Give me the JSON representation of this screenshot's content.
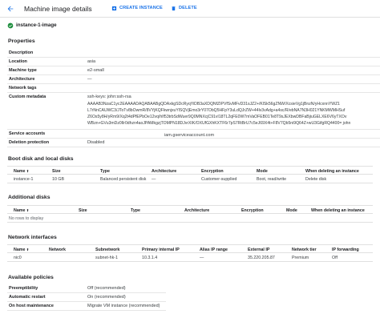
{
  "header": {
    "title": "Machine image details",
    "create_label": "CREATE INSTANCE",
    "delete_label": "DELETE"
  },
  "status": {
    "name": "instance-1-image"
  },
  "properties": {
    "title": "Properties",
    "rows": [
      {
        "key": "Description",
        "value": ""
      },
      {
        "key": "Location",
        "value": "asia"
      },
      {
        "key": "Machine type",
        "value": "e2-small"
      },
      {
        "key": "Architecture",
        "value": "—"
      },
      {
        "key": "Network tags",
        "value": ""
      },
      {
        "key": "Custom metadata",
        "value": "ssh-keys: john:ssh-rsa"
      }
    ],
    "metadata_lines": [
      "AAAAB3NzaC1yc2EAAAADAQABAABgQDAxkgSDcRyqYiDB3aXDQNfZIPVfSvMFvD31sJZ2+/KlSk56gZNW/XcsieVg1jBnzN/yHcxnnYWZ1",
      "L7rNnCAUWC3/JToTv8bOwmR/8VYjKQFkwnjxuYlSQVjEmo3rY07ObQ5HFpY3uLdQJrZW+44lv3vAdg+a4sc/R/ebNA7N3H021YNKMWMHSuf",
      "Z6Os5y8H/yRm9/Xq2t4dPfEPbOe12vq/hIf53trbSdWuer9Q0MNXcjC91vI18TL2qFE0W7mVaOFEB01Te8T9sJEXbwDBFaBjiuGELXE6V6yTXOv",
      "WBzn+GVu3mDz0Ilr0dhzn4aoJPAMkgzjTOMPN18DJvrXIK/OXUfGXhKXTF6r7pS7RtBrU7c5eJ69X4t+F8V7Qb5ni9Q64Z+wU3GifgRQ4400= john"
    ],
    "rows_after": [
      {
        "key": "Service accounts",
        "value": "iam.gserviceaccount.com"
      },
      {
        "key": "Deletion protection",
        "value": "Disabled"
      }
    ]
  },
  "boot_disks": {
    "title": "Boot disk and local disks",
    "headers": [
      "Name",
      "Size",
      "Type",
      "Architecture",
      "Encryption",
      "Mode",
      "When deleting an instance"
    ],
    "rows": [
      [
        "instance-1",
        "10 GB",
        "Balanced persistent disk",
        "—",
        "Customer-supplied",
        "Boot, read/write",
        "Delete disk"
      ]
    ]
  },
  "additional_disks": {
    "title": "Additional disks",
    "headers": [
      "Name",
      "Size",
      "Type",
      "Architecture",
      "Encryption",
      "Mode",
      "When deleting an instance"
    ],
    "empty_text": "No rows to display"
  },
  "network": {
    "title": "Network interfaces",
    "headers": [
      "Name",
      "Network",
      "Subnetwork",
      "Primary internal IP",
      "Alias IP range",
      "External IP",
      "Network tier",
      "IP forwarding"
    ],
    "rows": [
      [
        "nic0",
        "",
        "subnet-hk-1",
        "10.3.1.4",
        "—",
        "35.220.205.87",
        "Premium",
        "Off"
      ]
    ]
  },
  "policies": {
    "title": "Available policies",
    "rows": [
      {
        "key": "Preemptibility",
        "value": "Off (recommended)"
      },
      {
        "key": "Automatic restart",
        "value": "On (recommended)"
      },
      {
        "key": "On host maintenance",
        "value": "Migrate VM instance (recommended)"
      }
    ]
  },
  "colors": {
    "accent": "#1a73e8",
    "success": "#1e8e3e",
    "text": "#202124",
    "border": "#e0e0e0"
  }
}
